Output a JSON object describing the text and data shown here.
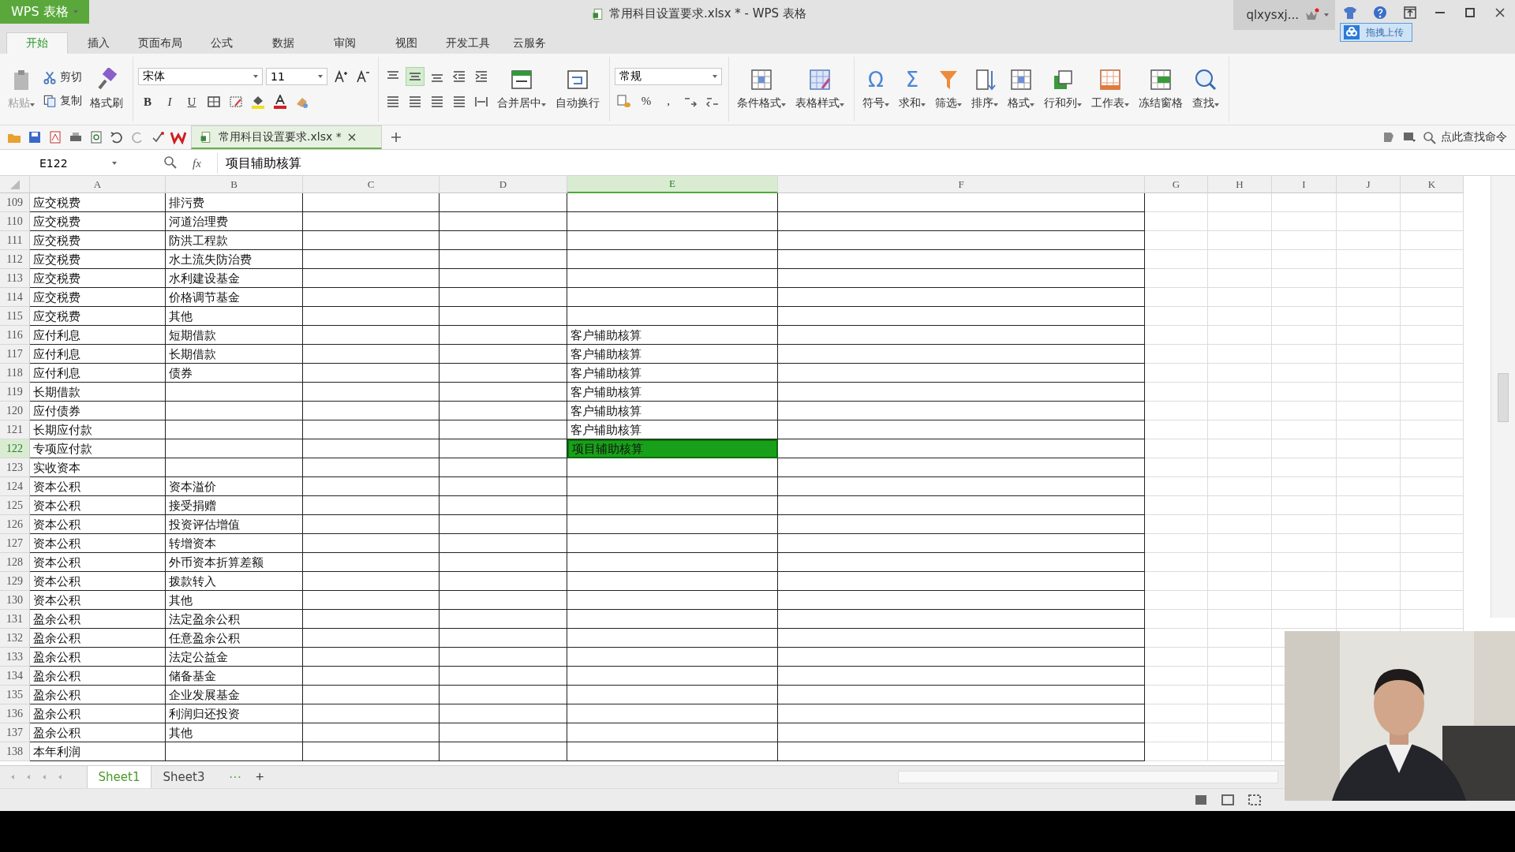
{
  "window": {
    "app_button": "WPS 表格",
    "title": "常用科目设置要求.xlsx * - WPS 表格",
    "user": "qlxysxj...",
    "upload_badge": "拖拽上传"
  },
  "menu_tabs": [
    {
      "label": "开始",
      "selected": true
    },
    {
      "label": "插入",
      "selected": false
    },
    {
      "label": "页面布局",
      "selected": false
    },
    {
      "label": "公式",
      "selected": false
    },
    {
      "label": "数据",
      "selected": false
    },
    {
      "label": "审阅",
      "selected": false
    },
    {
      "label": "视图",
      "selected": false
    },
    {
      "label": "开发工具",
      "selected": false
    },
    {
      "label": "云服务",
      "selected": false
    }
  ],
  "clipboard": [
    {
      "label": "粘贴",
      "kind": "clipboard",
      "disabled": true,
      "dropdown": true
    },
    {
      "label": "剪切",
      "kind": "scissors",
      "disabled": false,
      "dropdown": false
    },
    {
      "label": "复制",
      "kind": "copy",
      "disabled": false,
      "dropdown": false
    },
    {
      "label": "格式刷",
      "kind": "brush",
      "disabled": false,
      "dropdown": false
    }
  ],
  "font": {
    "family": "宋体",
    "size": "11",
    "style_buttons": [
      "B",
      "I",
      "U"
    ]
  },
  "align_buttons": [
    {
      "kind": "top",
      "selected": false
    },
    {
      "kind": "middle",
      "selected": true
    },
    {
      "kind": "bottom",
      "selected": false
    },
    {
      "kind": "outdent",
      "selected": false
    },
    {
      "kind": "indent",
      "selected": false
    }
  ],
  "wrap_buttons": [
    {
      "label": "合并居中",
      "kind": "merge",
      "dropdown": true
    },
    {
      "label": "自动换行",
      "kind": "wrap",
      "dropdown": false
    }
  ],
  "number": {
    "format": "常规",
    "symbols": [
      "%",
      ","
    ]
  },
  "tool_buttons": [
    {
      "label": "条件格式",
      "kind": "grid",
      "dropdown": true
    },
    {
      "label": "表格样式",
      "kind": "table",
      "dropdown": true
    },
    {
      "label": "符号",
      "kind": "glyph",
      "glyph": "Ω",
      "dropdown": true
    },
    {
      "label": "求和",
      "kind": "glyph",
      "glyph": "Σ",
      "dropdown": true
    },
    {
      "label": "筛选",
      "kind": "funnel",
      "dropdown": true
    },
    {
      "label": "排序",
      "kind": "sort",
      "dropdown": true
    },
    {
      "label": "格式",
      "kind": "grid",
      "dropdown": true
    },
    {
      "label": "行和列",
      "kind": "columns",
      "dropdown": true
    },
    {
      "label": "工作表",
      "kind": "sheet",
      "dropdown": true
    },
    {
      "label": "冻结窗格",
      "kind": "freeze",
      "dropdown": false
    },
    {
      "label": "查找",
      "kind": "find",
      "dropdown": true
    }
  ],
  "doc_tab": {
    "label": "常用科目设置要求.xlsx *"
  },
  "command_search": {
    "placeholder": "点此查找命令"
  },
  "formula_bar": {
    "name_box": "E122",
    "fx": "fx",
    "value": "项目辅助核算"
  },
  "columns": [
    {
      "label": "A",
      "selected": false
    },
    {
      "label": "B",
      "selected": false
    },
    {
      "label": "C",
      "selected": false
    },
    {
      "label": "D",
      "selected": false
    },
    {
      "label": "E",
      "selected": true
    },
    {
      "label": "F",
      "selected": false
    },
    {
      "label": "G",
      "selected": false
    },
    {
      "label": "H",
      "selected": false
    },
    {
      "label": "I",
      "selected": false
    },
    {
      "label": "J",
      "selected": false
    },
    {
      "label": "K",
      "selected": false
    }
  ],
  "rows": [
    {
      "number": "109",
      "selected": false,
      "a": "应交税费",
      "b": "排污费"
    },
    {
      "number": "110",
      "selected": false,
      "a": "应交税费",
      "b": "河道治理费"
    },
    {
      "number": "111",
      "selected": false,
      "a": "应交税费",
      "b": "防洪工程款"
    },
    {
      "number": "112",
      "selected": false,
      "a": "应交税费",
      "b": "水土流失防治费"
    },
    {
      "number": "113",
      "selected": false,
      "a": "应交税费",
      "b": "水利建设基金"
    },
    {
      "number": "114",
      "selected": false,
      "a": "应交税费",
      "b": "价格调节基金"
    },
    {
      "number": "115",
      "selected": false,
      "a": "应交税费",
      "b": "其他"
    },
    {
      "number": "116",
      "selected": false,
      "a": "应付利息",
      "b": "短期借款",
      "e": "客户辅助核算"
    },
    {
      "number": "117",
      "selected": false,
      "a": "应付利息",
      "b": "长期借款",
      "e": "客户辅助核算"
    },
    {
      "number": "118",
      "selected": false,
      "a": "应付利息",
      "b": "债券",
      "e": "客户辅助核算"
    },
    {
      "number": "119",
      "selected": false,
      "a": "长期借款",
      "e": "客户辅助核算"
    },
    {
      "number": "120",
      "selected": false,
      "a": "应付债券",
      "e": "客户辅助核算"
    },
    {
      "number": "121",
      "selected": false,
      "a": "长期应付款",
      "e": "客户辅助核算"
    },
    {
      "number": "122",
      "selected": true,
      "a": "专项应付款",
      "e": "项目辅助核算"
    },
    {
      "number": "123",
      "selected": false,
      "a": "实收资本"
    },
    {
      "number": "124",
      "selected": false,
      "a": "资本公积",
      "b": "资本溢价"
    },
    {
      "number": "125",
      "selected": false,
      "a": "资本公积",
      "b": "接受捐赠"
    },
    {
      "number": "126",
      "selected": false,
      "a": "资本公积",
      "b": "投资评估增值"
    },
    {
      "number": "127",
      "selected": false,
      "a": "资本公积",
      "b": "转增资本"
    },
    {
      "number": "128",
      "selected": false,
      "a": "资本公积",
      "b": "外币资本折算差额"
    },
    {
      "number": "129",
      "selected": false,
      "a": "资本公积",
      "b": "拨款转入"
    },
    {
      "number": "130",
      "selected": false,
      "a": "资本公积",
      "b": "其他"
    },
    {
      "number": "131",
      "selected": false,
      "a": "盈余公积",
      "b": "法定盈余公积"
    },
    {
      "number": "132",
      "selected": false,
      "a": "盈余公积",
      "b": "任意盈余公积"
    },
    {
      "number": "133",
      "selected": false,
      "a": "盈余公积",
      "b": "法定公益金"
    },
    {
      "number": "134",
      "selected": false,
      "a": "盈余公积",
      "b": "储备基金"
    },
    {
      "number": "135",
      "selected": false,
      "a": "盈余公积",
      "b": "企业发展基金"
    },
    {
      "number": "136",
      "selected": false,
      "a": "盈余公积",
      "b": "利润归还投资"
    },
    {
      "number": "137",
      "selected": false,
      "a": "盈余公积",
      "b": "其他"
    },
    {
      "number": "138",
      "selected": false,
      "a": "本年利润"
    }
  ],
  "sheet_tabs": [
    {
      "label": "Sheet1",
      "selected": true
    },
    {
      "label": "Sheet3",
      "selected": false
    }
  ],
  "sheet_more": "···",
  "sheet_add": "+"
}
